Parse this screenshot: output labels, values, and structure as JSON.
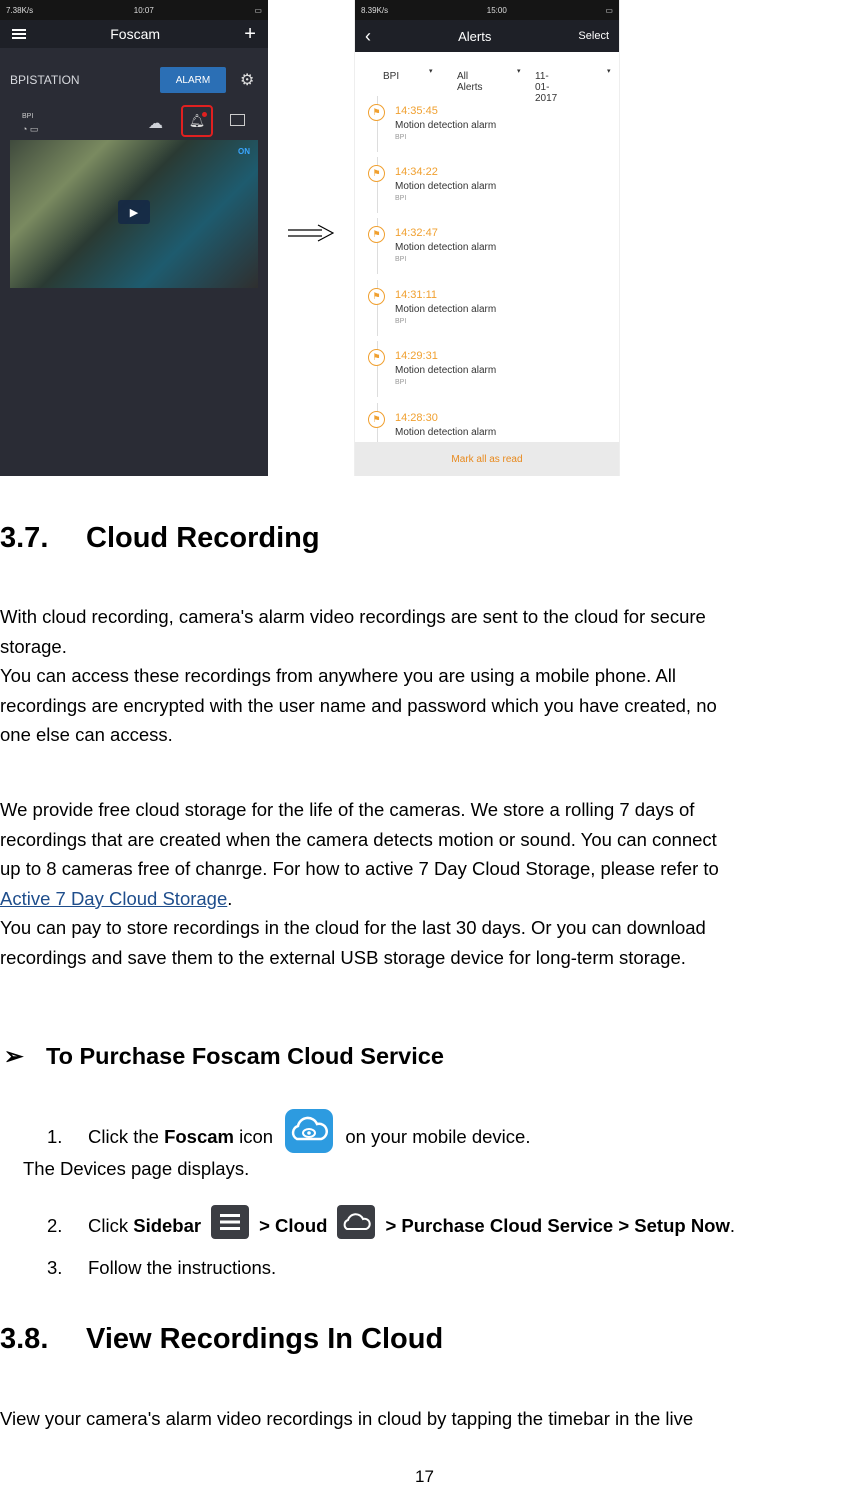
{
  "phone1": {
    "status_left": "\u0000",
    "status_net": "7.38K/s",
    "status_time": "10:07",
    "app_title": "Foscam",
    "device_name": "BPISTATION",
    "alarm_button": "ALARM",
    "camera_label": "BPI",
    "video_status": "ON"
  },
  "phone2": {
    "status_net": "8.39K/s",
    "status_time": "15:00",
    "title": "Alerts",
    "select_label": "Select",
    "filter_device": "BPI",
    "filter_type": "All Alerts",
    "filter_date": "11-01-2017",
    "alerts": [
      {
        "time": "14:35:45",
        "desc": "Motion detection alarm",
        "device": "BPI"
      },
      {
        "time": "14:34:22",
        "desc": "Motion detection alarm",
        "device": "BPI"
      },
      {
        "time": "14:32:47",
        "desc": "Motion detection alarm",
        "device": "BPI"
      },
      {
        "time": "14:31:11",
        "desc": "Motion detection alarm",
        "device": "BPI"
      },
      {
        "time": "14:29:31",
        "desc": "Motion detection alarm",
        "device": "BPI"
      },
      {
        "time": "14:28:30",
        "desc": "Motion detection alarm",
        "device": ""
      }
    ],
    "mark_all": "Mark all as read"
  },
  "section_37": {
    "number": "3.7.",
    "title": "Cloud Recording",
    "para1_l1": "With cloud recording, camera's alarm video recordings are sent to the cloud for secure",
    "para1_l2": "storage.",
    "para1_l3": "You can access these recordings from anywhere you are using a mobile phone. All",
    "para1_l4": "recordings are encrypted with the user name and password which you have created, no",
    "para1_l5": "one else can access.",
    "para2_l1": "We provide free cloud storage for the life of the cameras. We store a rolling 7 days of",
    "para2_l2": "recordings that are created when the camera detects motion or sound. You can connect",
    "para2_l3": "up to 8 cameras free of chanrge. For how to active 7 Day Cloud Storage, please refer to",
    "link_text": "Active 7 Day Cloud Storage",
    "para2_l5": "You can pay to store recordings in the cloud for the last 30 days. Or you can download",
    "para2_l6": "recordings and save them to the external USB storage device for long-term storage."
  },
  "purchase": {
    "bullet": "➢",
    "title": "To Purchase Foscam Cloud Service",
    "step1_num": "1.",
    "step1_pre": "Click the ",
    "step1_bold": "Foscam",
    "step1_mid": " icon ",
    "step1_post": " on your mobile device.",
    "step1_note": "The Devices page displays.",
    "step2_num": "2.",
    "step2_pre": "Click ",
    "step2_b1": "Sidebar",
    "step2_b2": "> Cloud",
    "step2_b3": "> Purchase Cloud Service > Setup Now",
    "step3_num": "3.",
    "step3_text": "Follow the instructions."
  },
  "section_38": {
    "number": "3.8.",
    "title": "View Recordings In Cloud",
    "para1": "View your camera's alarm video recordings in cloud by tapping the timebar in the live"
  },
  "page_number": "17",
  "colors": {
    "link": "#1f4e8c",
    "accent_orange": "#f0a030",
    "alarm_blue": "#2b6fb5",
    "alert_red": "#e02020"
  }
}
